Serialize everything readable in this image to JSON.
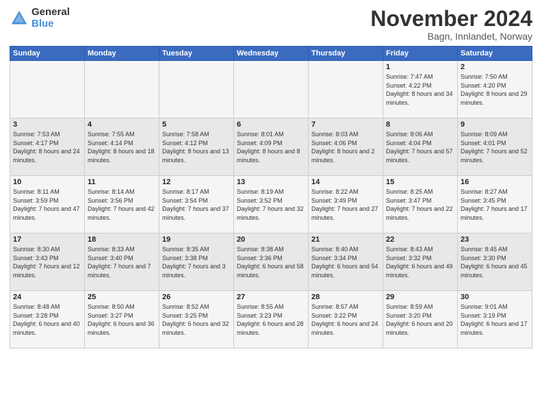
{
  "logo": {
    "general": "General",
    "blue": "Blue"
  },
  "title": "November 2024",
  "location": "Bagn, Innlandet, Norway",
  "headers": [
    "Sunday",
    "Monday",
    "Tuesday",
    "Wednesday",
    "Thursday",
    "Friday",
    "Saturday"
  ],
  "weeks": [
    [
      {
        "day": "",
        "sunrise": "",
        "sunset": "",
        "daylight": ""
      },
      {
        "day": "",
        "sunrise": "",
        "sunset": "",
        "daylight": ""
      },
      {
        "day": "",
        "sunrise": "",
        "sunset": "",
        "daylight": ""
      },
      {
        "day": "",
        "sunrise": "",
        "sunset": "",
        "daylight": ""
      },
      {
        "day": "",
        "sunrise": "",
        "sunset": "",
        "daylight": ""
      },
      {
        "day": "1",
        "sunrise": "Sunrise: 7:47 AM",
        "sunset": "Sunset: 4:22 PM",
        "daylight": "Daylight: 8 hours and 34 minutes."
      },
      {
        "day": "2",
        "sunrise": "Sunrise: 7:50 AM",
        "sunset": "Sunset: 4:20 PM",
        "daylight": "Daylight: 8 hours and 29 minutes."
      }
    ],
    [
      {
        "day": "3",
        "sunrise": "Sunrise: 7:53 AM",
        "sunset": "Sunset: 4:17 PM",
        "daylight": "Daylight: 8 hours and 24 minutes."
      },
      {
        "day": "4",
        "sunrise": "Sunrise: 7:55 AM",
        "sunset": "Sunset: 4:14 PM",
        "daylight": "Daylight: 8 hours and 18 minutes."
      },
      {
        "day": "5",
        "sunrise": "Sunrise: 7:58 AM",
        "sunset": "Sunset: 4:12 PM",
        "daylight": "Daylight: 8 hours and 13 minutes."
      },
      {
        "day": "6",
        "sunrise": "Sunrise: 8:01 AM",
        "sunset": "Sunset: 4:09 PM",
        "daylight": "Daylight: 8 hours and 8 minutes."
      },
      {
        "day": "7",
        "sunrise": "Sunrise: 8:03 AM",
        "sunset": "Sunset: 4:06 PM",
        "daylight": "Daylight: 8 hours and 2 minutes."
      },
      {
        "day": "8",
        "sunrise": "Sunrise: 8:06 AM",
        "sunset": "Sunset: 4:04 PM",
        "daylight": "Daylight: 7 hours and 57 minutes."
      },
      {
        "day": "9",
        "sunrise": "Sunrise: 8:09 AM",
        "sunset": "Sunset: 4:01 PM",
        "daylight": "Daylight: 7 hours and 52 minutes."
      }
    ],
    [
      {
        "day": "10",
        "sunrise": "Sunrise: 8:11 AM",
        "sunset": "Sunset: 3:59 PM",
        "daylight": "Daylight: 7 hours and 47 minutes."
      },
      {
        "day": "11",
        "sunrise": "Sunrise: 8:14 AM",
        "sunset": "Sunset: 3:56 PM",
        "daylight": "Daylight: 7 hours and 42 minutes."
      },
      {
        "day": "12",
        "sunrise": "Sunrise: 8:17 AM",
        "sunset": "Sunset: 3:54 PM",
        "daylight": "Daylight: 7 hours and 37 minutes."
      },
      {
        "day": "13",
        "sunrise": "Sunrise: 8:19 AM",
        "sunset": "Sunset: 3:52 PM",
        "daylight": "Daylight: 7 hours and 32 minutes."
      },
      {
        "day": "14",
        "sunrise": "Sunrise: 8:22 AM",
        "sunset": "Sunset: 3:49 PM",
        "daylight": "Daylight: 7 hours and 27 minutes."
      },
      {
        "day": "15",
        "sunrise": "Sunrise: 8:25 AM",
        "sunset": "Sunset: 3:47 PM",
        "daylight": "Daylight: 7 hours and 22 minutes."
      },
      {
        "day": "16",
        "sunrise": "Sunrise: 8:27 AM",
        "sunset": "Sunset: 3:45 PM",
        "daylight": "Daylight: 7 hours and 17 minutes."
      }
    ],
    [
      {
        "day": "17",
        "sunrise": "Sunrise: 8:30 AM",
        "sunset": "Sunset: 3:43 PM",
        "daylight": "Daylight: 7 hours and 12 minutes."
      },
      {
        "day": "18",
        "sunrise": "Sunrise: 8:33 AM",
        "sunset": "Sunset: 3:40 PM",
        "daylight": "Daylight: 7 hours and 7 minutes."
      },
      {
        "day": "19",
        "sunrise": "Sunrise: 8:35 AM",
        "sunset": "Sunset: 3:38 PM",
        "daylight": "Daylight: 7 hours and 3 minutes."
      },
      {
        "day": "20",
        "sunrise": "Sunrise: 8:38 AM",
        "sunset": "Sunset: 3:36 PM",
        "daylight": "Daylight: 6 hours and 58 minutes."
      },
      {
        "day": "21",
        "sunrise": "Sunrise: 8:40 AM",
        "sunset": "Sunset: 3:34 PM",
        "daylight": "Daylight: 6 hours and 54 minutes."
      },
      {
        "day": "22",
        "sunrise": "Sunrise: 8:43 AM",
        "sunset": "Sunset: 3:32 PM",
        "daylight": "Daylight: 6 hours and 49 minutes."
      },
      {
        "day": "23",
        "sunrise": "Sunrise: 8:45 AM",
        "sunset": "Sunset: 3:30 PM",
        "daylight": "Daylight: 6 hours and 45 minutes."
      }
    ],
    [
      {
        "day": "24",
        "sunrise": "Sunrise: 8:48 AM",
        "sunset": "Sunset: 3:28 PM",
        "daylight": "Daylight: 6 hours and 40 minutes."
      },
      {
        "day": "25",
        "sunrise": "Sunrise: 8:50 AM",
        "sunset": "Sunset: 3:27 PM",
        "daylight": "Daylight: 6 hours and 36 minutes."
      },
      {
        "day": "26",
        "sunrise": "Sunrise: 8:52 AM",
        "sunset": "Sunset: 3:25 PM",
        "daylight": "Daylight: 6 hours and 32 minutes."
      },
      {
        "day": "27",
        "sunrise": "Sunrise: 8:55 AM",
        "sunset": "Sunset: 3:23 PM",
        "daylight": "Daylight: 6 hours and 28 minutes."
      },
      {
        "day": "28",
        "sunrise": "Sunrise: 8:57 AM",
        "sunset": "Sunset: 3:22 PM",
        "daylight": "Daylight: 6 hours and 24 minutes."
      },
      {
        "day": "29",
        "sunrise": "Sunrise: 8:59 AM",
        "sunset": "Sunset: 3:20 PM",
        "daylight": "Daylight: 6 hours and 20 minutes."
      },
      {
        "day": "30",
        "sunrise": "Sunrise: 9:01 AM",
        "sunset": "Sunset: 3:19 PM",
        "daylight": "Daylight: 6 hours and 17 minutes."
      }
    ]
  ]
}
